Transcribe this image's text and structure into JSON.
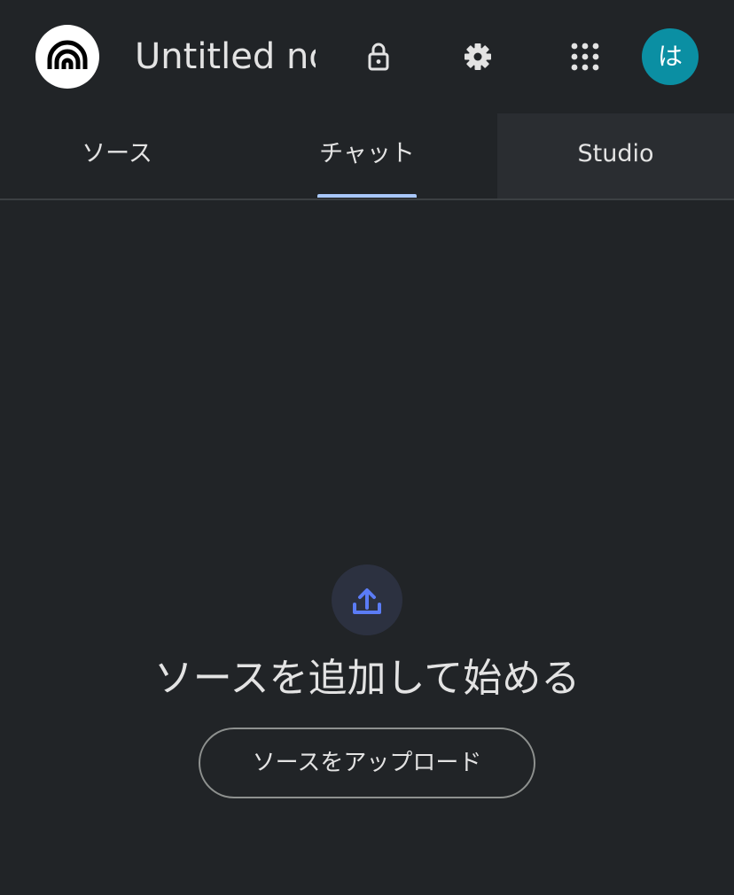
{
  "header": {
    "logo_icon": "notebooklm-logo-icon",
    "title": "Untitled notebook",
    "lock_icon": "lock-icon",
    "settings_icon": "gear-icon",
    "apps_icon": "apps-grid-icon",
    "avatar_letter": "は",
    "avatar_color": "#0b8fa3"
  },
  "tabs": [
    {
      "label": "ソース",
      "selected": false
    },
    {
      "label": "チャット",
      "selected": true
    },
    {
      "label": "Studio",
      "selected": false
    }
  ],
  "colors": {
    "background": "#212427",
    "accent": "#a8c7fa",
    "upload_icon": "#5b7cf6"
  },
  "empty_state": {
    "icon": "upload-icon",
    "heading": "ソースを追加して始める",
    "button_label": "ソースをアップロード"
  }
}
